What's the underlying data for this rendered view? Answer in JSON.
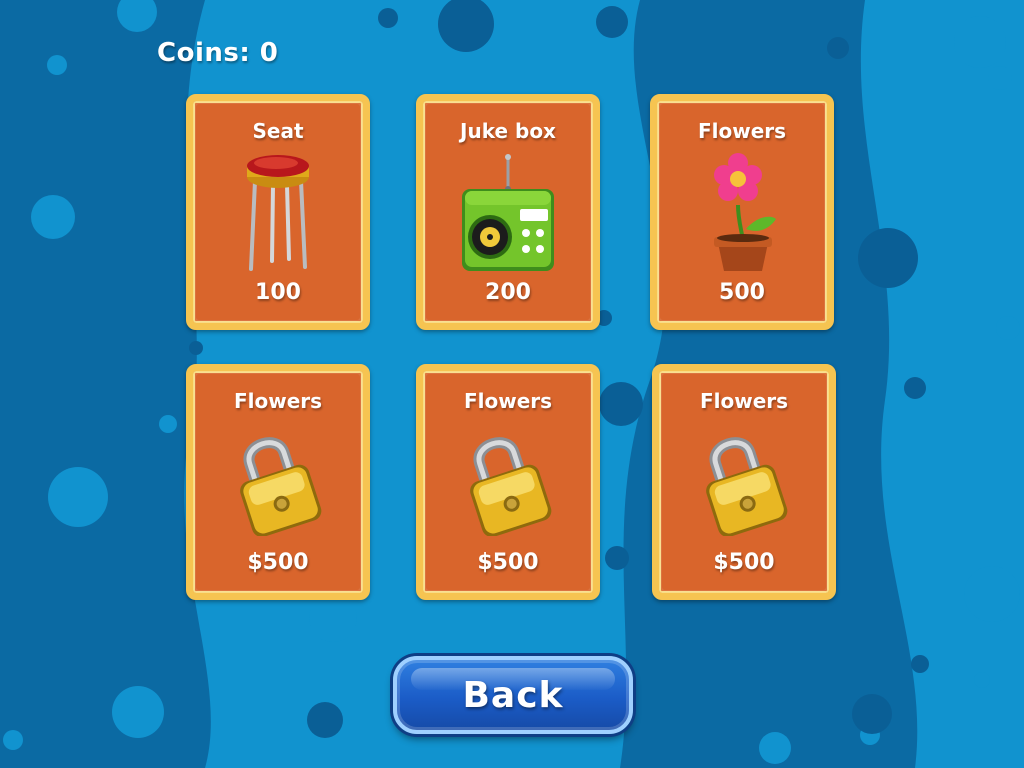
{
  "header": {
    "coins_label": "Coins: 0"
  },
  "shop": {
    "items": [
      {
        "title": "Seat",
        "price": "100",
        "icon": "stool-icon",
        "locked": false
      },
      {
        "title": "Juke box",
        "price": "200",
        "icon": "radio-icon",
        "locked": false
      },
      {
        "title": "Flowers",
        "price": "500",
        "icon": "flower-pot-icon",
        "locked": false
      },
      {
        "title": "Flowers",
        "price": "$500",
        "icon": "padlock-icon",
        "locked": true
      },
      {
        "title": "Flowers",
        "price": "$500",
        "icon": "padlock-icon",
        "locked": true
      },
      {
        "title": "Flowers",
        "price": "$500",
        "icon": "padlock-icon",
        "locked": true
      }
    ]
  },
  "footer": {
    "back_label": "Back"
  },
  "colors": {
    "background": "#0b6aa3",
    "stripe": "#1193cf",
    "card_fill": "#d9652c",
    "card_border": "#f6c451",
    "button": "#1b5cc7"
  }
}
